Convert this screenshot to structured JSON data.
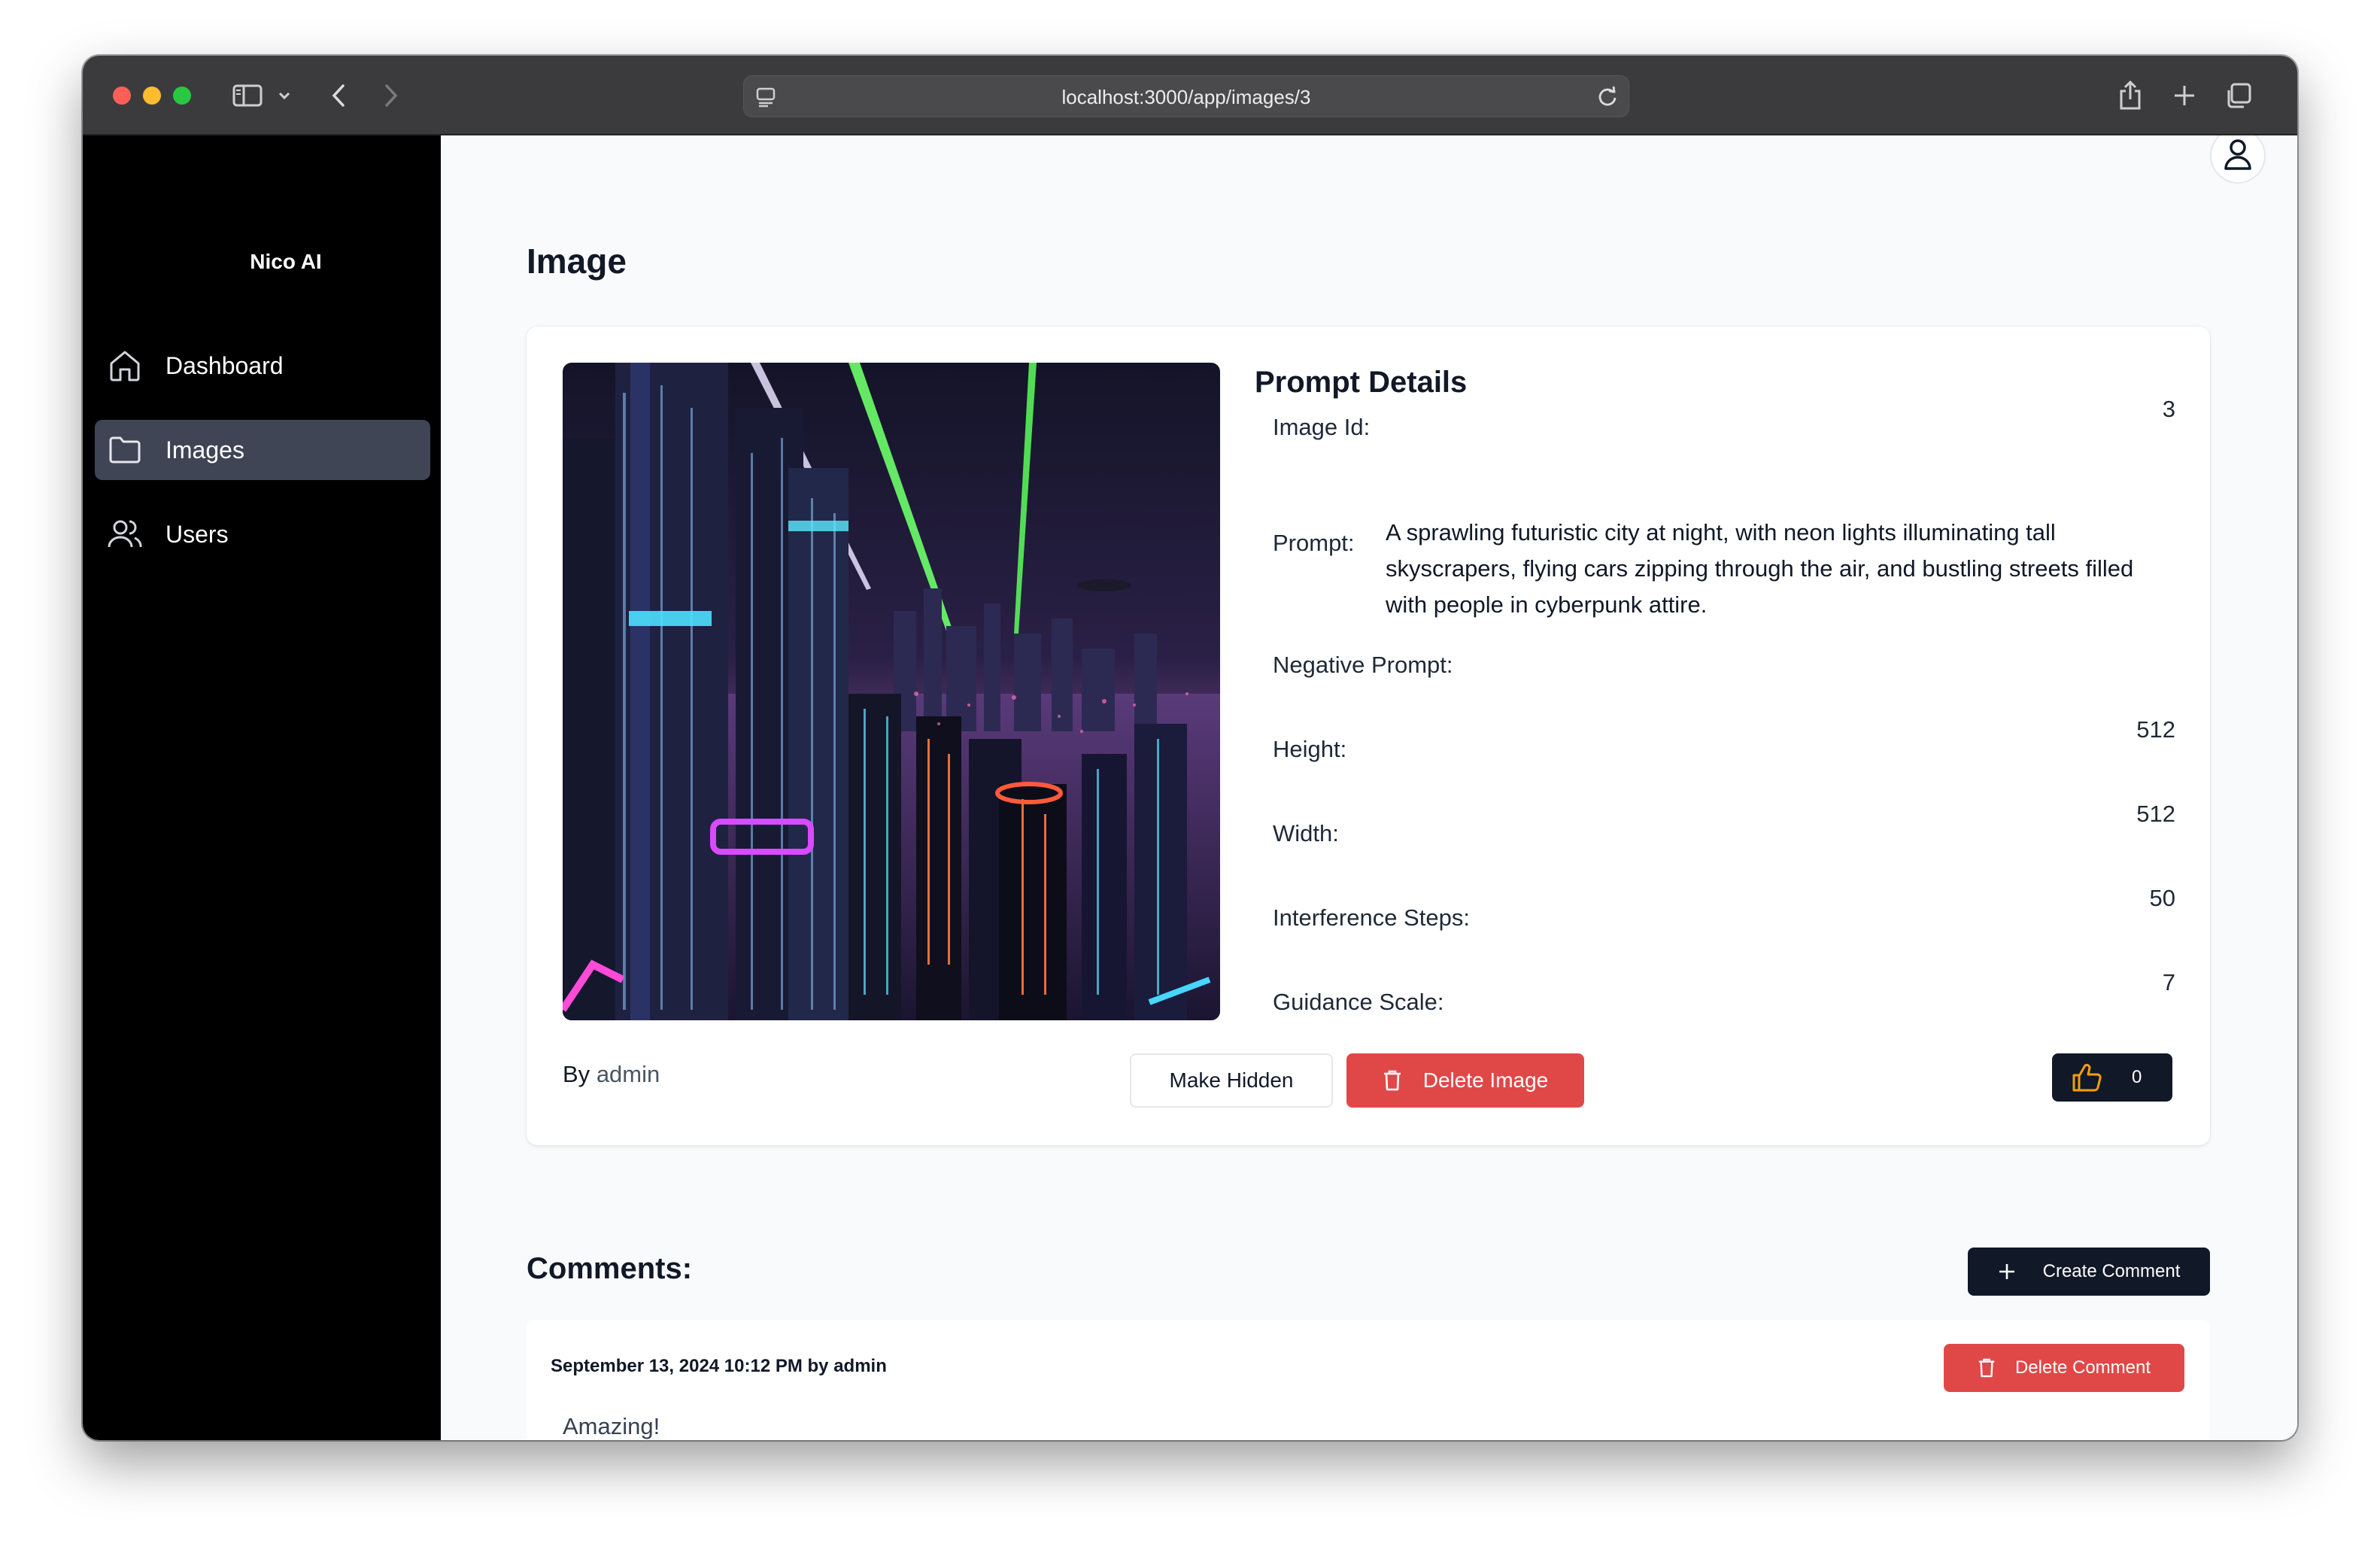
{
  "browser": {
    "url": "localhost:3000/app/images/3"
  },
  "sidebar": {
    "brand": "Nico AI",
    "items": [
      {
        "label": "Dashboard",
        "icon": "home-icon",
        "active": false
      },
      {
        "label": "Images",
        "icon": "folder-icon",
        "active": true
      },
      {
        "label": "Users",
        "icon": "users-icon",
        "active": false
      }
    ]
  },
  "page": {
    "title": "Image"
  },
  "details": {
    "title": "Prompt Details",
    "image_id_label": "Image Id:",
    "image_id": "3",
    "prompt_label": "Prompt:",
    "prompt": "A sprawling futuristic city at night, with neon lights illuminating tall skyscrapers, flying cars zipping through the air, and bustling streets filled with people in cyberpunk attire.",
    "negative_prompt_label": "Negative Prompt:",
    "negative_prompt": "",
    "height_label": "Height:",
    "height": "512",
    "width_label": "Width:",
    "width": "512",
    "steps_label": "Interference Steps:",
    "steps": "50",
    "guidance_label": "Guidance Scale:",
    "guidance": "7"
  },
  "image_meta": {
    "by_label": "By",
    "author": "admin"
  },
  "actions": {
    "make_hidden": "Make Hidden",
    "delete_image": "Delete Image",
    "likes": "0"
  },
  "comments": {
    "title": "Comments:",
    "create_button": "Create Comment",
    "items": [
      {
        "meta": "September 13, 2024 10:12 PM by admin",
        "body": "Amazing!",
        "delete_label": "Delete Comment"
      }
    ]
  },
  "colors": {
    "danger": "#e04848",
    "dark_button": "#111827",
    "active_nav": "#3f4555",
    "like_icon": "#f59e0b"
  }
}
